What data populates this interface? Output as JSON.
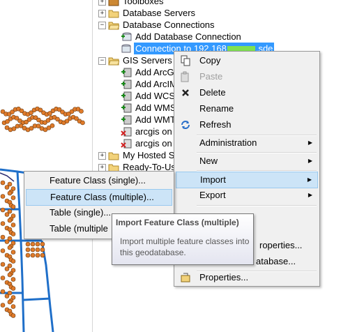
{
  "tree": {
    "items": [
      {
        "label": "Toolboxes",
        "expander": "+"
      },
      {
        "label": "Database Servers",
        "expander": "+"
      },
      {
        "label": "Database Connections",
        "expander": "−"
      },
      {
        "label": "Add Database Connection"
      },
      {
        "label": "Connection to 192.168",
        "suffix": ".sde"
      },
      {
        "label": "GIS Servers",
        "expander": "−"
      },
      {
        "label": "Add ArcG"
      },
      {
        "label": "Add ArcIM"
      },
      {
        "label": "Add WCS"
      },
      {
        "label": "Add WMS"
      },
      {
        "label": "Add WMT"
      },
      {
        "label": "arcgis on"
      },
      {
        "label": "arcgis on"
      },
      {
        "label": "My Hosted S",
        "expander": "+"
      },
      {
        "label": "Ready-To-Us",
        "expander": "+"
      }
    ]
  },
  "context_menu": {
    "items": [
      {
        "label": "Copy"
      },
      {
        "label": "Paste"
      },
      {
        "label": "Delete"
      },
      {
        "label": "Rename"
      },
      {
        "label": "Refresh"
      },
      {
        "label": "Administration"
      },
      {
        "label": "New"
      },
      {
        "label": "Import"
      },
      {
        "label": "Export"
      },
      {
        "label": "roperties..."
      },
      {
        "label": "atabase..."
      },
      {
        "label": "Properties..."
      }
    ],
    "submenu_arrow": "▶"
  },
  "submenu": {
    "items": [
      {
        "label": "Feature Class (single)..."
      },
      {
        "label": "Feature Class (multiple)..."
      },
      {
        "label": "Table (single)..."
      },
      {
        "label": "Table (multiple"
      }
    ]
  },
  "tooltip": {
    "title": "Import Feature Class (multiple)",
    "description": "Import multiple feature classes into this geodatabase."
  },
  "colors": {
    "selection": "#3399ff",
    "highlight": "#cce4f7",
    "map_line": "#1f6fc9",
    "map_point": "#e07b2a"
  }
}
